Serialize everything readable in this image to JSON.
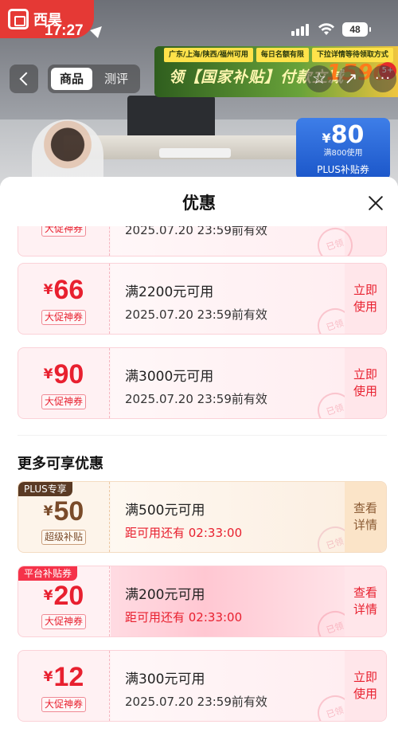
{
  "status_bar": {
    "time": "17:27",
    "battery": "48"
  },
  "brand": {
    "name": "西昊"
  },
  "product_nav": {
    "tabs": [
      {
        "label": "商品"
      },
      {
        "label": "测评"
      }
    ]
  },
  "banner": {
    "chips": [
      "广东/上海/陕西/福州可用",
      "每日名额有限",
      "下拉详情等待领取方式"
    ],
    "headline": "领【国家补贴】付款立减",
    "number": "1590",
    "badge": "5+"
  },
  "plus_coupon": {
    "symbol": "¥",
    "amount": "80",
    "condition": "满800使用",
    "label": "PLUS补贴券"
  },
  "sheet": {
    "title": "优惠"
  },
  "partial_coupon": {
    "tag": "大促神券",
    "validity": "2025.07.20 23:59前有效",
    "stamp": "已领"
  },
  "products": {
    "coupons": [
      {
        "symbol": "¥",
        "amount": "66",
        "tag": "大促神券",
        "condition": "满2200元可用",
        "validity": "2025.07.20 23:59前有效",
        "action": "立即\n使用",
        "stamp": "已领"
      },
      {
        "symbol": "¥",
        "amount": "90",
        "tag": "大促神券",
        "condition": "满3000元可用",
        "validity": "2025.07.20 23:59前有效",
        "action": "立即\n使用",
        "stamp": "已领"
      }
    ]
  },
  "more_section": {
    "title": "更多可享优惠",
    "coupons": [
      {
        "corner": "PLUS专享",
        "symbol": "¥",
        "amount": "50",
        "tag": "超级补贴",
        "condition": "满500元可用",
        "countdown": "距可用还有 02:33:00",
        "action": "查看\n详情",
        "stamp": "已领"
      },
      {
        "corner": "平台补贴券",
        "symbol": "¥",
        "amount": "20",
        "tag": "大促神券",
        "condition": "满200元可用",
        "countdown": "距可用还有 02:33:00",
        "action": "查看\n详情",
        "stamp": "已领"
      },
      {
        "symbol": "¥",
        "amount": "12",
        "tag": "大促神券",
        "condition": "满300元可用",
        "validity": "2025.07.20 23:59前有效",
        "action": "立即\n使用",
        "stamp": "已领"
      }
    ]
  },
  "colors": {
    "accent_red": "#e8202f",
    "plus_brown": "#5a3a24",
    "coupon_bg": "#fff1f3"
  }
}
